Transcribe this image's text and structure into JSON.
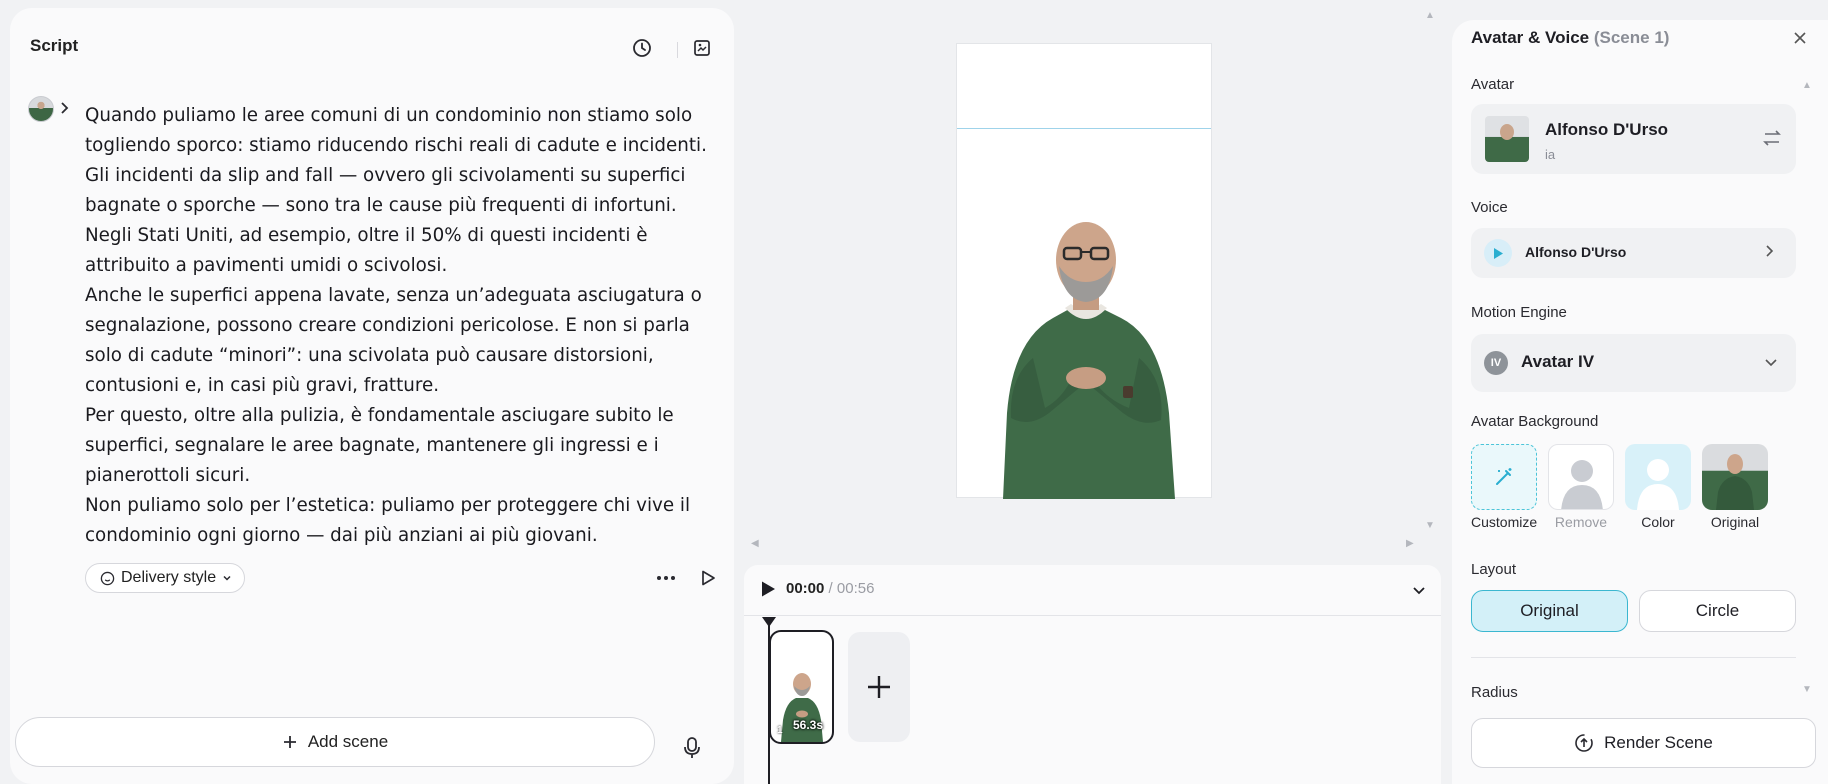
{
  "script_panel": {
    "title": "Script",
    "paragraphs": [
      "Quando puliamo le aree comuni di un condominio non stiamo solo",
      "togliendo sporco: stiamo riducendo rischi reali di cadute e incidenti.",
      "Gli incidenti da slip and fall — ovvero gli scivolamenti su superfici",
      "bagnate o sporche — sono tra le cause più frequenti di infortuni.",
      "Negli Stati Uniti, ad esempio, oltre il 50% di questi incidenti è",
      "attribuito a pavimenti umidi o scivolosi.",
      "Anche le superfici appena lavate, senza un’adeguata asciugatura o",
      "segnalazione, possono creare condizioni pericolose. E non si parla",
      "solo di cadute “minori”: una scivolata può causare distorsioni,",
      "contusioni e, in casi più gravi, fratture.",
      "Per questo, oltre alla pulizia, è fondamentale asciugare subito le",
      "superfici, segnalare le aree bagnate, mantenere gli ingressi e i",
      "pianerottoli sicuri.",
      "Non puliamo solo per l’estetica: puliamo per proteggere chi vive il",
      "condominio ogni giorno — dai più anziani ai più giovani."
    ],
    "delivery_style_label": "Delivery style",
    "add_scene_label": "Add scene",
    "icons": [
      "history-icon",
      "storyboard-icon",
      "chevron-right-icon",
      "more-icon",
      "play-icon",
      "plus-icon",
      "microphone-icon"
    ]
  },
  "timeline": {
    "current_time": "00:00",
    "separator": "/",
    "total_time": "00:56",
    "scenes": [
      {
        "number": "1",
        "duration": "56.3s"
      }
    ]
  },
  "right_panel": {
    "title": "Avatar & Voice",
    "scene_label": "(Scene 1)",
    "avatar_section_label": "Avatar",
    "avatar": {
      "name": "Alfonso D'Urso",
      "subtitle": "ia"
    },
    "voice_section_label": "Voice",
    "voice": {
      "name": "Alfonso D'Urso"
    },
    "motion_engine_label": "Motion Engine",
    "motion_engine": {
      "badge": "IV",
      "name": "Avatar IV"
    },
    "avatar_background_label": "Avatar Background",
    "background_options": [
      "Customize",
      "Remove",
      "Color",
      "Original"
    ],
    "layout_label": "Layout",
    "layout_options": [
      "Original",
      "Circle"
    ],
    "layout_selected": "Original",
    "radius_label": "Radius",
    "render_label": "Render Scene"
  },
  "colors": {
    "accent": "#3bb7d0",
    "accent_light": "#d3f0f8",
    "panel_bg": "#fafafb",
    "page_bg": "#f1f2f4"
  }
}
